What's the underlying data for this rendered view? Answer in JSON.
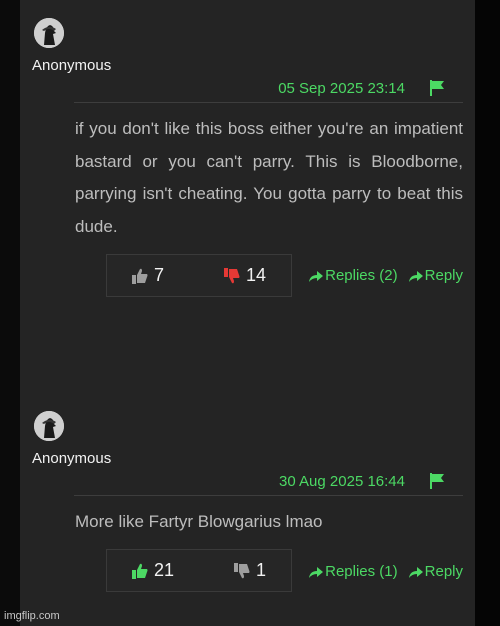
{
  "comments": [
    {
      "author": "Anonymous",
      "timestamp": "05 Sep 2025 23:14",
      "text": "if you don't like this boss either you're an impatient bastard or you can't parry. This is Bloodborne, parrying isn't cheating. You gotta parry to beat this dude.",
      "upvotes": "7",
      "downvotes": "14",
      "upvote_icon_color": "#9e9e9e",
      "downvote_icon_color": "#e53935",
      "replies_label": "Replies (2)",
      "reply_label": "Reply"
    },
    {
      "author": "Anonymous",
      "timestamp": "30 Aug 2025 16:44",
      "text": "More like Fartyr Blowgarius lmao",
      "upvotes": "21",
      "downvotes": "1",
      "upvote_icon_color": "#4cd964",
      "downvote_icon_color": "#9e9e9e",
      "replies_label": "Replies (1)",
      "reply_label": "Reply"
    }
  ],
  "icons": {
    "avatar": "avatar-icon",
    "flag": "flag-icon",
    "upvote": "thumbs-up-icon",
    "downvote": "thumbs-down-icon",
    "reply_arrow": "reply-arrow-icon"
  },
  "colors": {
    "accent": "#4cd964",
    "panel": "#242424",
    "text": "#bdbdbd"
  },
  "watermark": "imgflip.com"
}
